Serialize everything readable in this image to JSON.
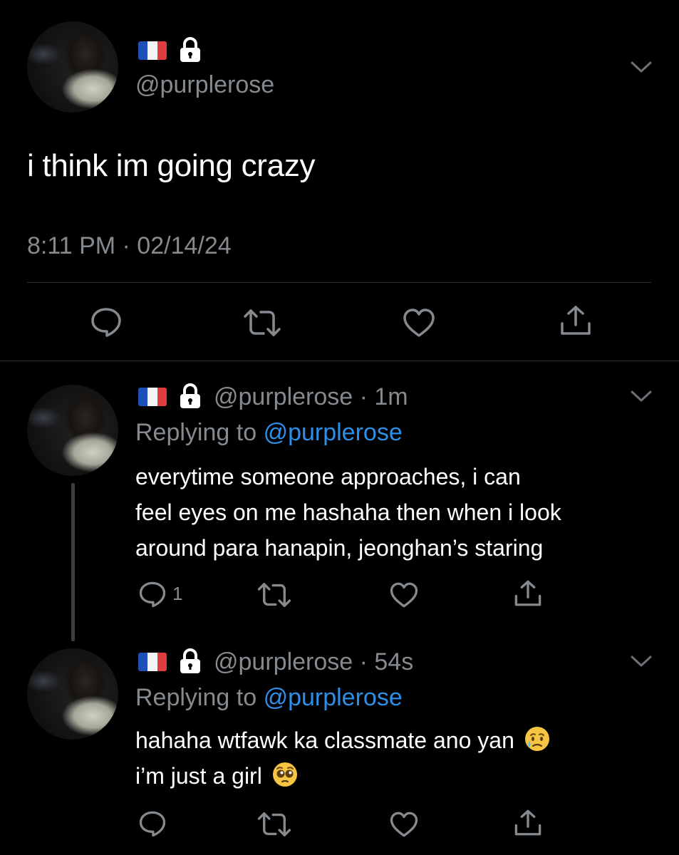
{
  "main_tweet": {
    "handle": "@purplerose",
    "text": "i think im going crazy",
    "timestamp": "8:11 PM · 02/14/24",
    "actions": [
      "reply-icon",
      "retweet-icon",
      "like-icon",
      "share-icon"
    ]
  },
  "replies": [
    {
      "handle": "@purplerose",
      "time": "· 1m",
      "replying_prefix": "Replying to",
      "replying_handle": "@purplerose",
      "lines": [
        "everytime someone approaches, i can",
        "feel eyes on me hashaha then when i look",
        "around para hanapin, jeonghan’s staring"
      ],
      "reply_count": "1"
    },
    {
      "handle": "@purplerose",
      "time": "· 54s",
      "replying_prefix": "Replying to",
      "replying_handle": "@purplerose",
      "lines": [
        "hahaha wtfawk ka classmate ano yan",
        "i’m just a girl"
      ],
      "emojis": [
        "sad-but-relieved-face-emoji",
        "pleading-face-emoji"
      ],
      "reply_count": ""
    }
  ],
  "colors": {
    "background": "#000000",
    "text": "#ffffff",
    "secondary": "#858a8f",
    "link": "#2e8fe6",
    "divider": "#2a2e32"
  }
}
